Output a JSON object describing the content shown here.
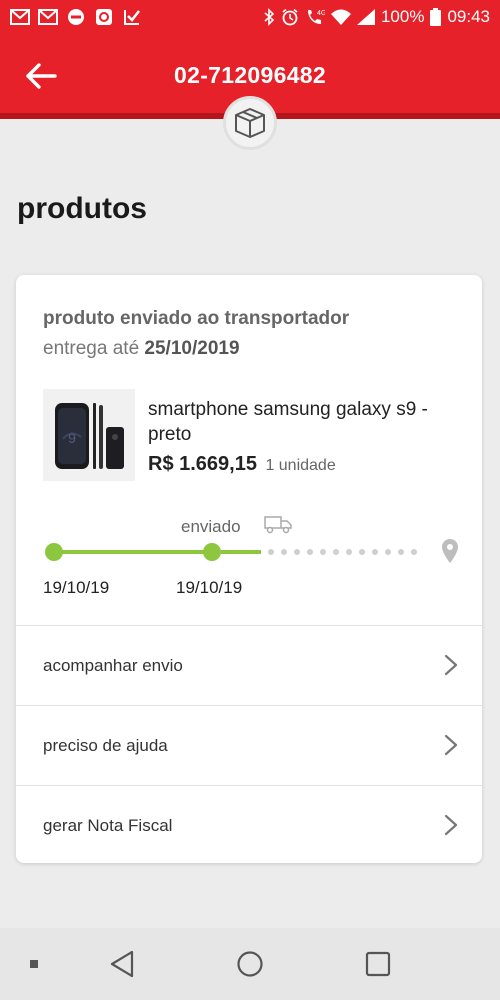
{
  "status_bar": {
    "battery": "100%",
    "time": "09:43",
    "network": "4G"
  },
  "header": {
    "order_number": "02-712096482",
    "back_icon": "arrow-left-icon",
    "badge_icon": "package-box-icon"
  },
  "section": {
    "title": "produtos"
  },
  "card": {
    "status": "produto enviado ao transportador",
    "delivery_prefix": "entrega até",
    "delivery_date": "25/10/2019",
    "product": {
      "name": "smartphone samsung galaxy s9 - preto",
      "price": "R$ 1.669,15",
      "quantity": "1 unidade"
    },
    "tracking": {
      "current_label": "enviado",
      "dates": [
        "19/10/19",
        "19/10/19"
      ]
    },
    "actions": [
      {
        "label": "acompanhar envio"
      },
      {
        "label": "preciso de ajuda"
      },
      {
        "label": "gerar Nota Fiscal"
      }
    ]
  },
  "colors": {
    "brand_red": "#e62129",
    "progress_green": "#8dc63f"
  }
}
